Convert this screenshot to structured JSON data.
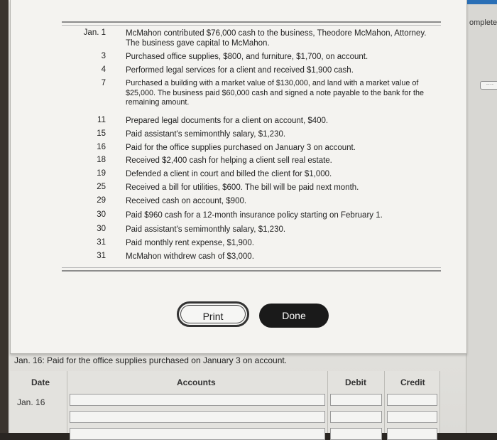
{
  "side": {
    "label": "omplete",
    "tag": "····"
  },
  "events": [
    {
      "date": "Jan. 1",
      "text": "McMahon contributed $76,000 cash to the business, Theodore McMahon, Attorney. The business gave capital to McMahon."
    },
    {
      "date": "3",
      "text": "Purchased office supplies, $800, and furniture, $1,700, on account."
    },
    {
      "date": "4",
      "text": "Performed legal services for a client and received $1,900 cash."
    },
    {
      "date": "7",
      "text": "Purchased a building with a market value of $130,000, and land with a market value of $25,000. The business paid $60,000 cash and signed a note payable to the bank for the remaining amount."
    },
    {
      "date": "11",
      "text": "Prepared legal documents for a client on account, $400."
    },
    {
      "date": "15",
      "text": "Paid assistant's semimonthly salary, $1,230."
    },
    {
      "date": "16",
      "text": "Paid for the office supplies purchased on January 3 on account."
    },
    {
      "date": "18",
      "text": "Received $2,400 cash for helping a client sell real estate."
    },
    {
      "date": "19",
      "text": "Defended a client in court and billed the client for $1,000."
    },
    {
      "date": "25",
      "text": "Received a bill for utilities, $600. The bill will be paid next month."
    },
    {
      "date": "29",
      "text": "Received cash on account, $900."
    },
    {
      "date": "30",
      "text": "Paid $960 cash for a 12-month insurance policy starting on February 1."
    },
    {
      "date": "30",
      "text": "Paid assistant's semimonthly salary, $1,230."
    },
    {
      "date": "31",
      "text": "Paid monthly rent expense, $1,900."
    },
    {
      "date": "31",
      "text": "McMahon withdrew cash of $3,000."
    }
  ],
  "buttons": {
    "print": "Print",
    "done": "Done"
  },
  "instruction": "Jan. 16: Paid for the office supplies purchased on January 3 on account.",
  "journal": {
    "headers": {
      "date": "Date",
      "accounts": "Accounts",
      "debit": "Debit",
      "credit": "Credit"
    },
    "row_date": "Jan. 16"
  }
}
